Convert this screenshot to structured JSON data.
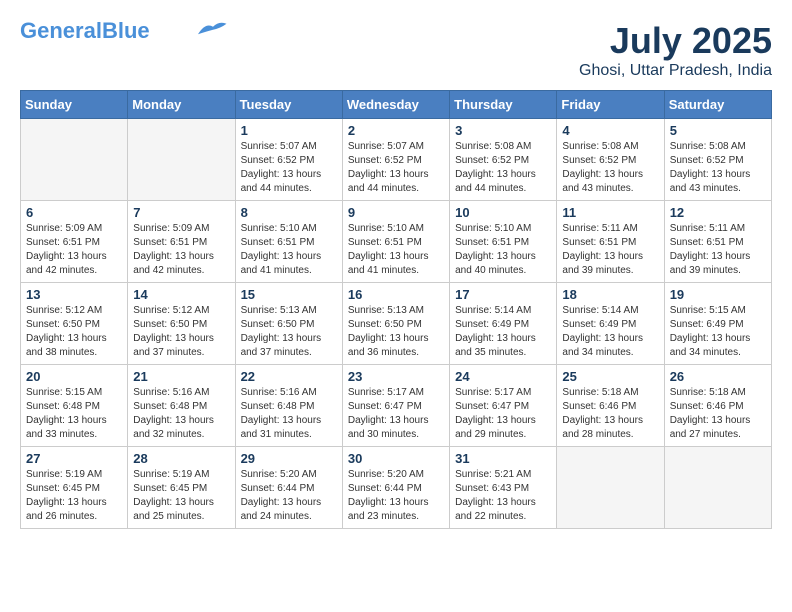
{
  "header": {
    "logo_line1": "General",
    "logo_line2": "Blue",
    "month_title": "July 2025",
    "subtitle": "Ghosi, Uttar Pradesh, India"
  },
  "days_of_week": [
    "Sunday",
    "Monday",
    "Tuesday",
    "Wednesday",
    "Thursday",
    "Friday",
    "Saturday"
  ],
  "weeks": [
    [
      {
        "day": "",
        "empty": true
      },
      {
        "day": "",
        "empty": true
      },
      {
        "day": "1",
        "sunrise": "5:07 AM",
        "sunset": "6:52 PM",
        "daylight": "13 hours and 44 minutes."
      },
      {
        "day": "2",
        "sunrise": "5:07 AM",
        "sunset": "6:52 PM",
        "daylight": "13 hours and 44 minutes."
      },
      {
        "day": "3",
        "sunrise": "5:08 AM",
        "sunset": "6:52 PM",
        "daylight": "13 hours and 44 minutes."
      },
      {
        "day": "4",
        "sunrise": "5:08 AM",
        "sunset": "6:52 PM",
        "daylight": "13 hours and 43 minutes."
      },
      {
        "day": "5",
        "sunrise": "5:08 AM",
        "sunset": "6:52 PM",
        "daylight": "13 hours and 43 minutes."
      }
    ],
    [
      {
        "day": "6",
        "sunrise": "5:09 AM",
        "sunset": "6:51 PM",
        "daylight": "13 hours and 42 minutes."
      },
      {
        "day": "7",
        "sunrise": "5:09 AM",
        "sunset": "6:51 PM",
        "daylight": "13 hours and 42 minutes."
      },
      {
        "day": "8",
        "sunrise": "5:10 AM",
        "sunset": "6:51 PM",
        "daylight": "13 hours and 41 minutes."
      },
      {
        "day": "9",
        "sunrise": "5:10 AM",
        "sunset": "6:51 PM",
        "daylight": "13 hours and 41 minutes."
      },
      {
        "day": "10",
        "sunrise": "5:10 AM",
        "sunset": "6:51 PM",
        "daylight": "13 hours and 40 minutes."
      },
      {
        "day": "11",
        "sunrise": "5:11 AM",
        "sunset": "6:51 PM",
        "daylight": "13 hours and 39 minutes."
      },
      {
        "day": "12",
        "sunrise": "5:11 AM",
        "sunset": "6:51 PM",
        "daylight": "13 hours and 39 minutes."
      }
    ],
    [
      {
        "day": "13",
        "sunrise": "5:12 AM",
        "sunset": "6:50 PM",
        "daylight": "13 hours and 38 minutes."
      },
      {
        "day": "14",
        "sunrise": "5:12 AM",
        "sunset": "6:50 PM",
        "daylight": "13 hours and 37 minutes."
      },
      {
        "day": "15",
        "sunrise": "5:13 AM",
        "sunset": "6:50 PM",
        "daylight": "13 hours and 37 minutes."
      },
      {
        "day": "16",
        "sunrise": "5:13 AM",
        "sunset": "6:50 PM",
        "daylight": "13 hours and 36 minutes."
      },
      {
        "day": "17",
        "sunrise": "5:14 AM",
        "sunset": "6:49 PM",
        "daylight": "13 hours and 35 minutes."
      },
      {
        "day": "18",
        "sunrise": "5:14 AM",
        "sunset": "6:49 PM",
        "daylight": "13 hours and 34 minutes."
      },
      {
        "day": "19",
        "sunrise": "5:15 AM",
        "sunset": "6:49 PM",
        "daylight": "13 hours and 34 minutes."
      }
    ],
    [
      {
        "day": "20",
        "sunrise": "5:15 AM",
        "sunset": "6:48 PM",
        "daylight": "13 hours and 33 minutes."
      },
      {
        "day": "21",
        "sunrise": "5:16 AM",
        "sunset": "6:48 PM",
        "daylight": "13 hours and 32 minutes."
      },
      {
        "day": "22",
        "sunrise": "5:16 AM",
        "sunset": "6:48 PM",
        "daylight": "13 hours and 31 minutes."
      },
      {
        "day": "23",
        "sunrise": "5:17 AM",
        "sunset": "6:47 PM",
        "daylight": "13 hours and 30 minutes."
      },
      {
        "day": "24",
        "sunrise": "5:17 AM",
        "sunset": "6:47 PM",
        "daylight": "13 hours and 29 minutes."
      },
      {
        "day": "25",
        "sunrise": "5:18 AM",
        "sunset": "6:46 PM",
        "daylight": "13 hours and 28 minutes."
      },
      {
        "day": "26",
        "sunrise": "5:18 AM",
        "sunset": "6:46 PM",
        "daylight": "13 hours and 27 minutes."
      }
    ],
    [
      {
        "day": "27",
        "sunrise": "5:19 AM",
        "sunset": "6:45 PM",
        "daylight": "13 hours and 26 minutes."
      },
      {
        "day": "28",
        "sunrise": "5:19 AM",
        "sunset": "6:45 PM",
        "daylight": "13 hours and 25 minutes."
      },
      {
        "day": "29",
        "sunrise": "5:20 AM",
        "sunset": "6:44 PM",
        "daylight": "13 hours and 24 minutes."
      },
      {
        "day": "30",
        "sunrise": "5:20 AM",
        "sunset": "6:44 PM",
        "daylight": "13 hours and 23 minutes."
      },
      {
        "day": "31",
        "sunrise": "5:21 AM",
        "sunset": "6:43 PM",
        "daylight": "13 hours and 22 minutes."
      },
      {
        "day": "",
        "empty": true
      },
      {
        "day": "",
        "empty": true
      }
    ]
  ]
}
